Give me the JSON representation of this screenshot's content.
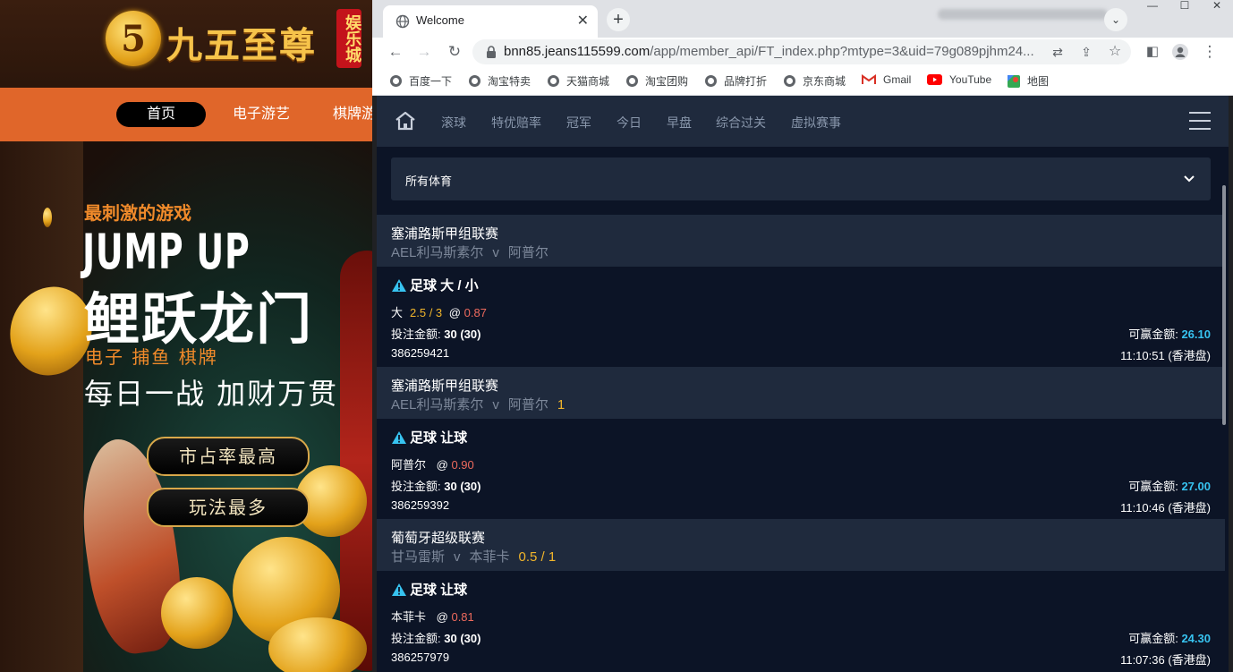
{
  "background_site": {
    "logo_text": "九五至尊",
    "logo_badge": "5",
    "logo_sub": "娱乐城",
    "nav": [
      "首页",
      "电子游艺",
      "棋牌游"
    ],
    "banner": {
      "line1": "最刺激的游戏",
      "line2": "JUMP UP",
      "line3": "鲤跃龙门",
      "line4": "电子  捕鱼  棋牌",
      "line5": "每日一战  加财万贯",
      "btn1": "市占率最高",
      "btn2": "玩法最多"
    }
  },
  "browser": {
    "tab_title": "Welcome",
    "url_host": "bnn85.jeans115599.com",
    "url_path": "/app/member_api/FT_index.php?mtype=3&uid=79g089pjhm24...",
    "bookmarks": [
      "百度一下",
      "淘宝特卖",
      "天猫商城",
      "淘宝团购",
      "品牌打折",
      "京东商城",
      "Gmail",
      "YouTube",
      "地图"
    ]
  },
  "page": {
    "nav": [
      "滚球",
      "特优赔率",
      "冠军",
      "今日",
      "早盘",
      "综合过关",
      "虚拟赛事"
    ],
    "sport_select": "所有体育",
    "entries": [
      {
        "league": "塞浦路斯甲组联赛",
        "home": "AEL利马斯素尔",
        "vs": "v",
        "away": "阿普尔",
        "handicap": "",
        "bet_type": "足球 大 / 小",
        "pick": "大",
        "line": "2.5 / 3",
        "at": "@",
        "odds": "0.87",
        "stake_label": "投注金额:",
        "stake": "30 (30)",
        "win_label": "可赢金额:",
        "win": "26.10",
        "ticket": "386259421",
        "time": "11:10:51 (香港盘)"
      },
      {
        "league": "塞浦路斯甲组联赛",
        "home": "AEL利马斯素尔",
        "vs": "v",
        "away": "阿普尔",
        "handicap": "1",
        "bet_type": "足球 让球",
        "pick": "阿普尔",
        "line": "",
        "at": "@",
        "odds": "0.90",
        "stake_label": "投注金额:",
        "stake": "30 (30)",
        "win_label": "可赢金额:",
        "win": "27.00",
        "ticket": "386259392",
        "time": "11:10:46 (香港盘)"
      },
      {
        "league": "葡萄牙超级联赛",
        "home": "甘马雷斯",
        "vs": "v",
        "away": "本菲卡",
        "handicap": "0.5 / 1",
        "bet_type": "足球 让球",
        "pick": "本菲卡",
        "line": "",
        "at": "@",
        "odds": "0.81",
        "stake_label": "投注金额:",
        "stake": "30 (30)",
        "win_label": "可赢金额:",
        "win": "24.30",
        "ticket": "386257979",
        "time": "11:07:36 (香港盘)"
      }
    ]
  },
  "colors": {
    "page_bg": "#0c1426",
    "header_bg": "#1f2a3d",
    "accent_yellow": "#f1b52b",
    "odds_red": "#ee6a5d",
    "win_blue": "#37c3f0"
  }
}
